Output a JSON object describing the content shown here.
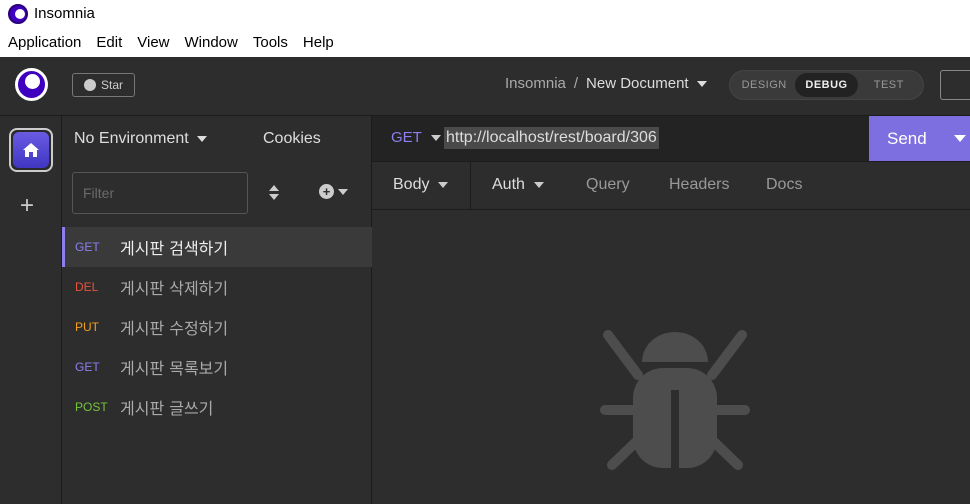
{
  "window": {
    "title": "Insomnia"
  },
  "menu": [
    "Application",
    "Edit",
    "View",
    "Window",
    "Tools",
    "Help"
  ],
  "header": {
    "star_label": "Star",
    "breadcrumb_root": "Insomnia",
    "breadcrumb_sep": "/",
    "document": "New Document",
    "modes": [
      "DESIGN",
      "DEBUG",
      "TEST"
    ],
    "active_mode": "DEBUG"
  },
  "sidebar": {
    "environment": "No Environment",
    "cookies": "Cookies",
    "filter_placeholder": "Filter",
    "requests": [
      {
        "method": "GET",
        "name": "게시판 검색하기",
        "color": "#8b7ff0",
        "active": true
      },
      {
        "method": "DEL",
        "name": "게시판 삭제하기",
        "color": "#e5533d",
        "active": false
      },
      {
        "method": "PUT",
        "name": "게시판 수정하기",
        "color": "#f0a020",
        "active": false
      },
      {
        "method": "GET",
        "name": "게시판 목록보기",
        "color": "#8b7ff0",
        "active": false
      },
      {
        "method": "POST",
        "name": "게시판 글쓰기",
        "color": "#74c43e",
        "active": false
      }
    ]
  },
  "request": {
    "method": "GET",
    "url": "http://localhost/rest/board/306",
    "send_label": "Send"
  },
  "tabs": [
    "Body",
    "Auth",
    "Query",
    "Headers",
    "Docs"
  ],
  "icons": {
    "home": "home-icon",
    "add": "plus-icon",
    "github": "github-icon",
    "empty_state": "bug-icon"
  }
}
